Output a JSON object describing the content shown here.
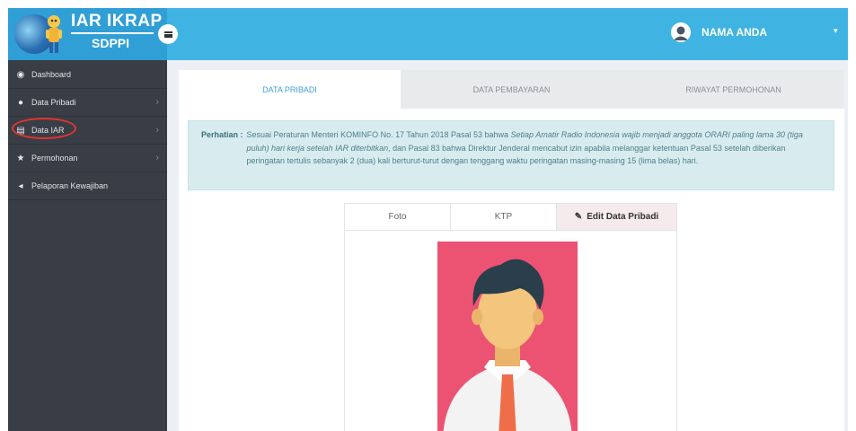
{
  "brand": {
    "title": "IAR IKRAP",
    "subtitle": "SDPPI"
  },
  "header": {
    "user_name": "NAMA ANDA",
    "caret": "▾"
  },
  "sidebar": {
    "items": [
      {
        "label": "Dashboard",
        "icon": "dashboard-icon",
        "glyph": "◉",
        "has_chevron": false
      },
      {
        "label": "Data Pribadi",
        "icon": "user-icon",
        "glyph": "●",
        "has_chevron": true
      },
      {
        "label": "Data IAR",
        "icon": "id-card-icon",
        "glyph": "▤",
        "has_chevron": true
      },
      {
        "label": "Permohonan",
        "icon": "star-icon",
        "glyph": "★",
        "has_chevron": true
      },
      {
        "label": "Pelaporan Kewajiban",
        "icon": "bullhorn-icon",
        "glyph": "◂",
        "has_chevron": false
      }
    ],
    "chevron": "›"
  },
  "tabs": {
    "items": [
      "DATA PRIBADI",
      "DATA PEMBAYARAN",
      "RIWAYAT PERMOHONAN"
    ],
    "active_index": 0
  },
  "alert": {
    "label": "Perhatian :",
    "text_1": "Sesuai Peraturan Menteri KOMINFO No. 17 Tahun 2018 Pasal 53 bahwa ",
    "text_italic": "Setiap Amatir Radio Indonesia wajib menjadi anggota ORARI paling lama 30 (tiga puluh) hari kerja setelah IAR diterbitkan",
    "text_2": ", dan Pasal 83 bahwa Direktur Jenderal mencabut izin apabila melanggar ketentuan Pasal 53 setelah diberikan peringatan tertulis sebanyak 2 (dua) kali berturut-turut dengan tenggang waktu peringatan masing-masing 15 (lima belas) hari."
  },
  "card": {
    "tab_foto": "Foto",
    "tab_ktp": "KTP",
    "edit_label": "Edit Data Pribadi",
    "edit_glyph": "✎"
  },
  "colors": {
    "topbar": "#3fb4e3",
    "sidebar": "#393e46",
    "active_tab_text": "#3fa2d6",
    "photo_bg": "#ec5373",
    "alert_bg": "#d8ecf0"
  }
}
